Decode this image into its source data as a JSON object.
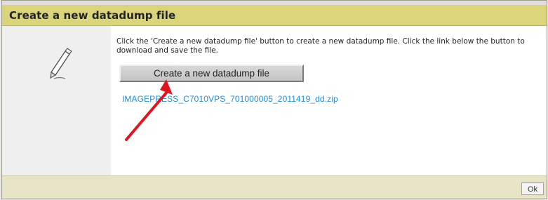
{
  "dialog": {
    "title": "Create a new datadump file",
    "description": "Click the 'Create a new datadump file' button to create a new datadump file. Click the link below the button to download and save the file.",
    "button_label": "Create a new datadump file",
    "download_link": "IMAGEPRESS_C7010VPS_701000005_2011419_dd.zip",
    "ok_label": "Ok"
  },
  "icons": {
    "left_icon": "pencil-icon",
    "annotation": "red-arrow-icon"
  },
  "colors": {
    "title_bar": "#dad57a",
    "footer_bar": "#e7e4c8",
    "link": "#1f8ad8",
    "annotation_arrow": "#e0141e"
  }
}
